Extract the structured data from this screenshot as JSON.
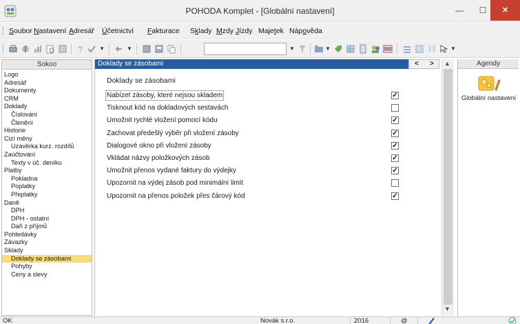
{
  "window": {
    "title": "POHODA Komplet - [Globální nastavení]",
    "minimize_glyph": "—",
    "maximize_glyph": "☐",
    "close_glyph": "✕",
    "app_icon": "pohoda-app-icon"
  },
  "menu": {
    "items": [
      {
        "pre": "",
        "u": "S",
        "post": "oubor"
      },
      {
        "pre": "",
        "u": "N",
        "post": "astavení"
      },
      {
        "pre": "",
        "u": "A",
        "post": "dresář"
      },
      {
        "pre": "",
        "u": "Ú",
        "post": "četnictví"
      },
      {
        "pre": "",
        "u": "F",
        "post": "akturace"
      },
      {
        "pre": "S",
        "u": "k",
        "post": "lady"
      },
      {
        "pre": "",
        "u": "M",
        "post": "zdy"
      },
      {
        "pre": "",
        "u": "J",
        "post": "ízdy"
      },
      {
        "pre": "Maje",
        "u": "t",
        "post": "ek"
      },
      {
        "pre": "Náp",
        "u": "o",
        "post": "věda"
      }
    ]
  },
  "toolbar": {
    "search_value": "",
    "dropdown_glyph": "▼"
  },
  "sidebar": {
    "header": "Sokoo",
    "items": [
      {
        "label": "Logo",
        "level": 0
      },
      {
        "label": "Adresář",
        "level": 0
      },
      {
        "label": "Dokumenty",
        "level": 0
      },
      {
        "label": "CRM",
        "level": 0
      },
      {
        "label": "Doklady",
        "level": 0
      },
      {
        "label": "Číslování",
        "level": 1
      },
      {
        "label": "Členění",
        "level": 1
      },
      {
        "label": "Historie",
        "level": 0
      },
      {
        "label": "Cizí měny",
        "level": 0
      },
      {
        "label": "Uzávěrka kurz. rozdílů",
        "level": 1
      },
      {
        "label": "Zaúčtování",
        "level": 0
      },
      {
        "label": "Texty v úč. deníku",
        "level": 1
      },
      {
        "label": "Platby",
        "level": 0
      },
      {
        "label": "Pokladna",
        "level": 1
      },
      {
        "label": "Poplatky",
        "level": 1
      },
      {
        "label": "Přeplatky",
        "level": 1
      },
      {
        "label": "Daně",
        "level": 0
      },
      {
        "label": "DPH",
        "level": 1
      },
      {
        "label": "DPH - ostatní",
        "level": 1
      },
      {
        "label": "Daň z příjmů",
        "level": 1
      },
      {
        "label": "Pohledávky",
        "level": 0
      },
      {
        "label": "Závazky",
        "level": 0
      },
      {
        "label": "Sklady",
        "level": 0
      },
      {
        "label": "Doklady se zásobami",
        "level": 1,
        "selected": true
      },
      {
        "label": "Pohyby",
        "level": 1
      },
      {
        "label": "Ceny a slevy",
        "level": 1
      }
    ]
  },
  "main": {
    "header": "Doklady se zásobami",
    "prev_glyph": "<",
    "next_glyph": ">",
    "section_title": "Doklady se zásobami",
    "options": [
      {
        "label": "Nabízet zásoby, které nejsou skladem",
        "checked": true,
        "focused": true
      },
      {
        "label": "Tisknout kód na dokladových sestavách",
        "checked": false
      },
      {
        "label": "Umožnit rychlé vložení pomocí kódu",
        "checked": true
      },
      {
        "label": "Zachovat předešlý výběr při vložení zásoby",
        "checked": true
      },
      {
        "label": "Dialogové okno při vložení zásoby",
        "checked": true
      },
      {
        "label": "Vkládat názvy položkových zásob",
        "checked": true
      },
      {
        "label": "Umožnit přenos vydané faktury do výdejky",
        "checked": true
      },
      {
        "label": "Upozornit na výdej zásob pod minimální limit",
        "checked": false
      },
      {
        "label": "Upozornit na přenos položek přes čárový kód",
        "checked": true
      }
    ]
  },
  "agendy": {
    "header": "Agendy",
    "item_label": "Globální nastavení"
  },
  "statusbar": {
    "status": "OK",
    "company": "Novák s.r.o.",
    "year": "2016",
    "at_glyph": "@"
  },
  "colors": {
    "accent_header": "#285c9e",
    "selected_item": "#f5dd7a",
    "close_button": "#c7402f"
  }
}
